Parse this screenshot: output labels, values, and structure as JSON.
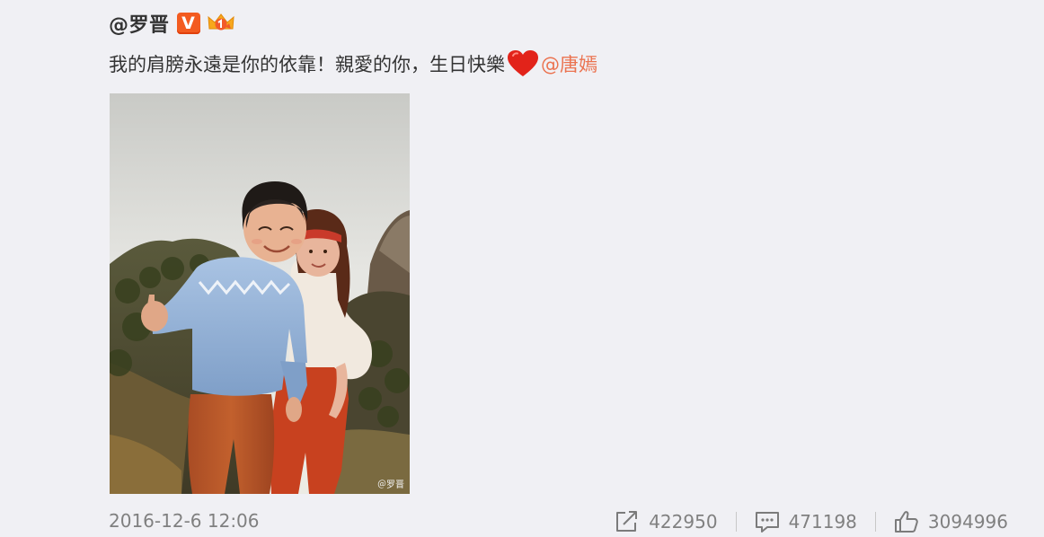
{
  "post": {
    "username": "@罗晋",
    "verify_badge_text": "V",
    "body_text": "我的肩膀永遠是你的依靠！親愛的你，生日快樂",
    "heart_icon": "red-heart-emoji",
    "mention": "@唐嫣",
    "photo_watermark": "＠罗晋",
    "timestamp": "2016-12-6 12:06"
  },
  "actions": {
    "repost_icon": "share-arrow-icon",
    "repost_count": "422950",
    "comment_icon": "comment-bubble-icon",
    "comment_count": "471198",
    "like_icon": "thumbs-up-icon",
    "like_count": "3094996"
  },
  "colors": {
    "background": "#f0f0f4",
    "mention": "#eb7350",
    "verify_badge": "#f35b20",
    "meta_text": "#808080"
  }
}
